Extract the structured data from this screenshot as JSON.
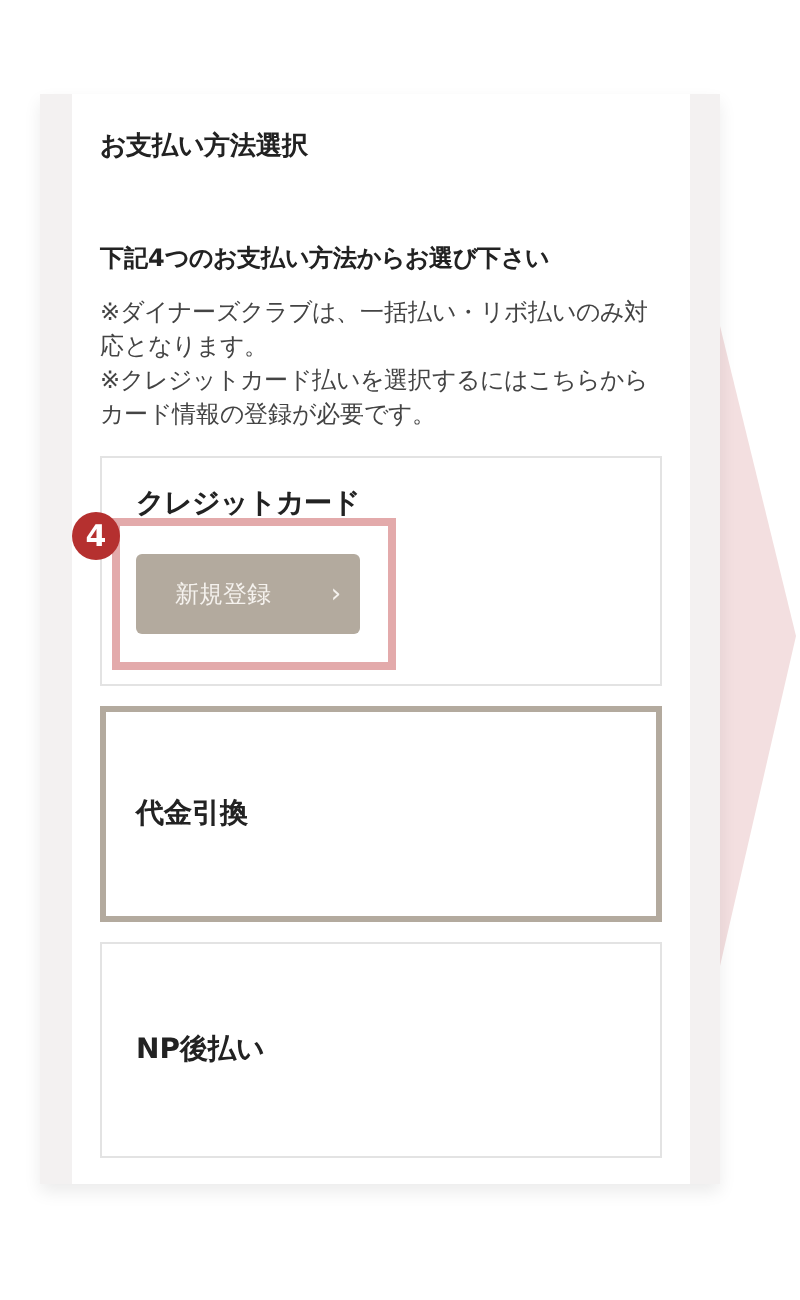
{
  "header": {
    "title": "お支払い方法選択"
  },
  "instruction": "下記4つのお支払い方法からお選び下さい",
  "notes": [
    "※ダイナーズクラブは、一括払い・リボ払いのみ対応となります。",
    "※クレジットカード払いを選択するにはこちらからカード情報の登録が必要です。"
  ],
  "methods": [
    {
      "kind": "card",
      "label": "クレジットカード",
      "selected": false,
      "button": {
        "label": "新規登録",
        "chevron": "›"
      },
      "callout": "4"
    },
    {
      "kind": "plain",
      "label": "代金引換",
      "selected": true
    },
    {
      "kind": "plain",
      "label": "NP後払い",
      "selected": false
    }
  ]
}
